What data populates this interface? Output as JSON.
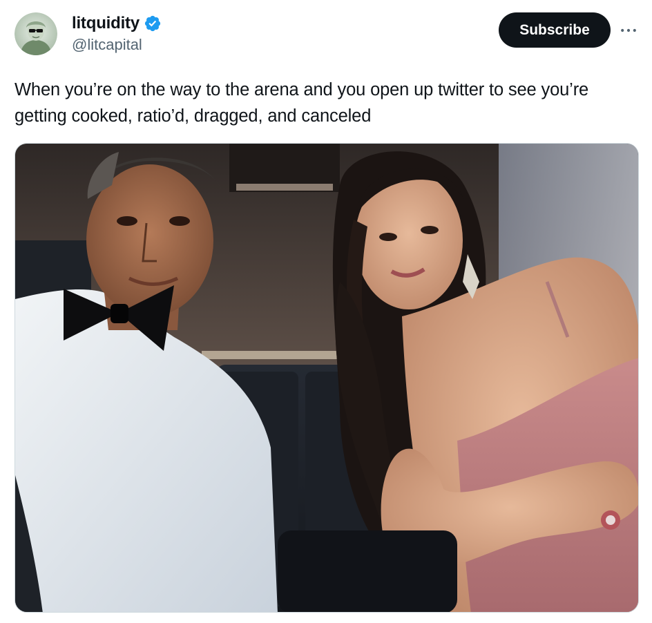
{
  "author": {
    "display_name": "litquidity",
    "handle": "@litcapital",
    "verified": true,
    "avatar_icon": "money-portrait-avatar"
  },
  "actions": {
    "subscribe_label": "Subscribe",
    "more_icon": "more-horizontal-icon"
  },
  "tweet": {
    "text": "When you’re on the way to the arena and you open up twitter to see you’re getting cooked, ratio’d, dragged, and canceled"
  },
  "colors": {
    "verified_blue": "#1d9bf0",
    "subscribe_bg": "#0f1419",
    "secondary_text": "#536471"
  }
}
